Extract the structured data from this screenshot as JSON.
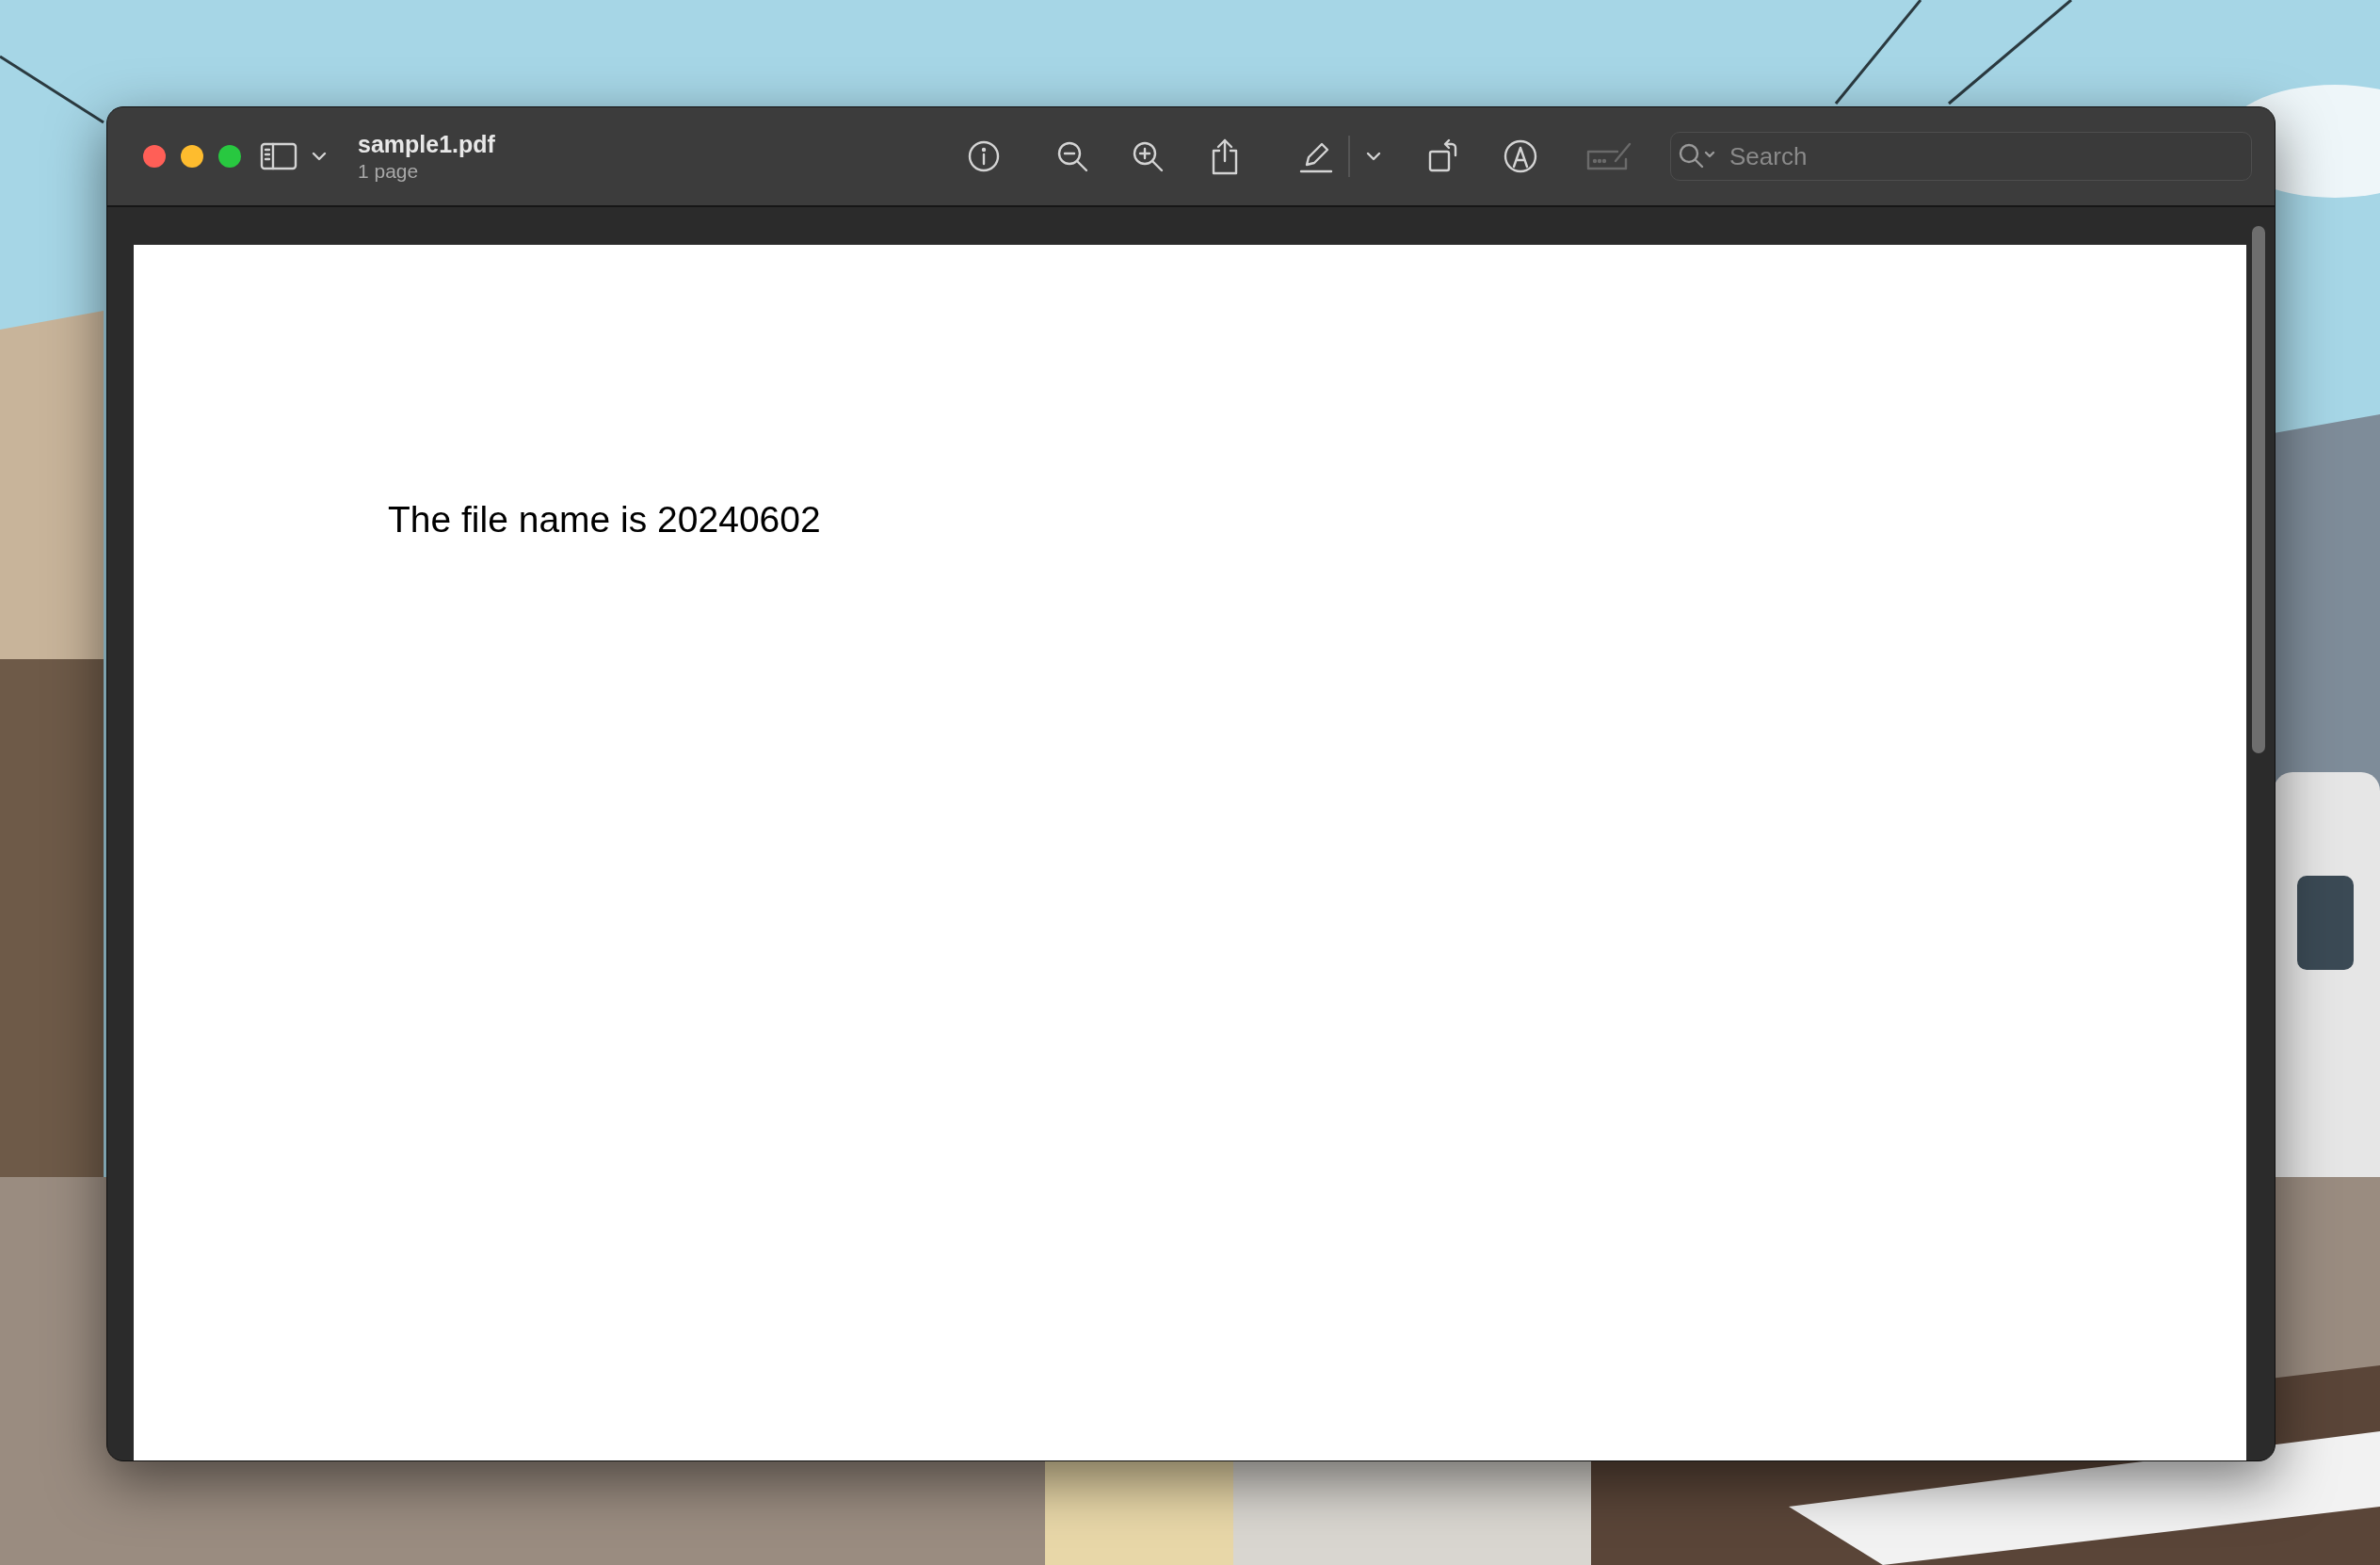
{
  "window": {
    "title": "sample1.pdf",
    "subtitle": "1 page"
  },
  "toolbar": [
    {
      "kind": "sidebar",
      "disabled": false
    },
    {
      "kind": "chevron",
      "disabled": false
    },
    {
      "kind": "info",
      "disabled": false
    },
    {
      "kind": "zoom-out",
      "disabled": false
    },
    {
      "kind": "zoom-in",
      "disabled": false
    },
    {
      "kind": "share",
      "disabled": false
    },
    {
      "kind": "highlight",
      "disabled": false
    },
    {
      "kind": "chevron",
      "disabled": false
    },
    {
      "kind": "rotate",
      "disabled": false
    },
    {
      "kind": "markup",
      "disabled": false
    },
    {
      "kind": "signature",
      "disabled": true
    }
  ],
  "search": {
    "placeholder": "Search"
  },
  "document": {
    "text": "The file name is 20240602"
  }
}
